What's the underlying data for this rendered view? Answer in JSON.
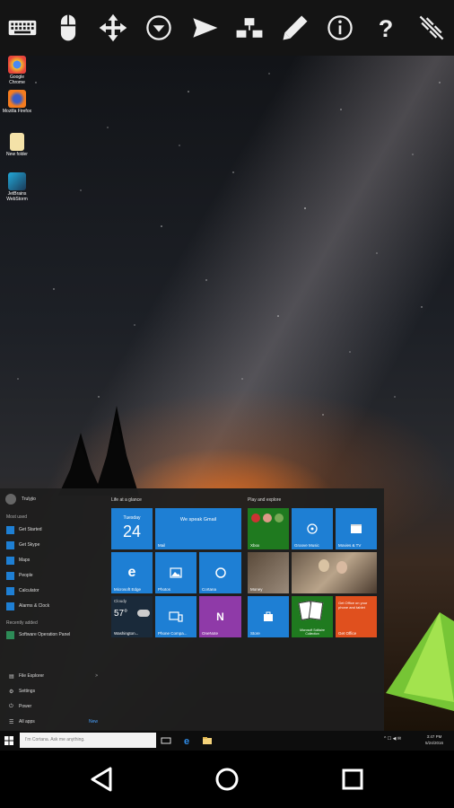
{
  "toolbar": {
    "icons": [
      "keyboard-icon",
      "mouse-icon",
      "move-arrows-icon",
      "dropdown-circle-icon",
      "send-icon",
      "network-icon",
      "pencil-icon",
      "info-icon",
      "help-icon",
      "disconnect-icon"
    ]
  },
  "desktop": {
    "icons": [
      {
        "label": "Google Chrome",
        "icon": "chrome-icon",
        "color": "#e8453c"
      },
      {
        "label": "Mozilla Firefox",
        "icon": "firefox-icon",
        "color": "#f57c1f"
      },
      {
        "label": "New folder",
        "icon": "folder-icon",
        "color": "#f4d27a"
      },
      {
        "label": "JetBrains WebStorm",
        "icon": "webstorm-icon",
        "color": "#22a8d8"
      }
    ]
  },
  "start_menu": {
    "user": "Trulyjio",
    "most_used_title": "Most used",
    "most_used": [
      "Get Started",
      "Get Skype",
      "Maps",
      "People",
      "Calculator",
      "Alarms & Clock"
    ],
    "recently_added_title": "Recently added",
    "recently_added": [
      "Software Operation Panel"
    ],
    "bottom": [
      {
        "label": "File Explorer",
        "glyph": "▤",
        "right": ">"
      },
      {
        "label": "Settings",
        "glyph": "⚙",
        "right": ""
      },
      {
        "label": "Power",
        "glyph": "⏻",
        "right": ""
      },
      {
        "label": "All apps",
        "glyph": "☰",
        "right": "New"
      }
    ],
    "group_life": "Life at a glance",
    "group_play": "Play and explore",
    "tiles": {
      "calendar_day": "Tuesday",
      "calendar_date": "24",
      "mail_text": "We speak Gmail",
      "mail_label": "Mail",
      "edge_label": "Microsoft Edge",
      "photos_label": "Photos",
      "cortana_label": "Cortana",
      "weather_cond": "Cloudy",
      "weather_temp": "57°",
      "weather_city": "Washington...",
      "phone_label": "Phone Compa...",
      "onenote_label": "OneNote",
      "xbox_label": "Xbox",
      "groove_label": "Groove Music",
      "movies_label": "Movies & TV",
      "money_label": "Money",
      "store_label": "Store",
      "solitaire_label": "Microsoft Solitaire Collection",
      "office_text": "Get Office on your phone and tablet",
      "office_label": "Get Office"
    }
  },
  "taskbar": {
    "search_placeholder": "I'm Cortana. Ask me anything.",
    "tray": "^ ☐ ◀ ✉",
    "time": "3:47 PM",
    "date": "5/24/2016"
  }
}
